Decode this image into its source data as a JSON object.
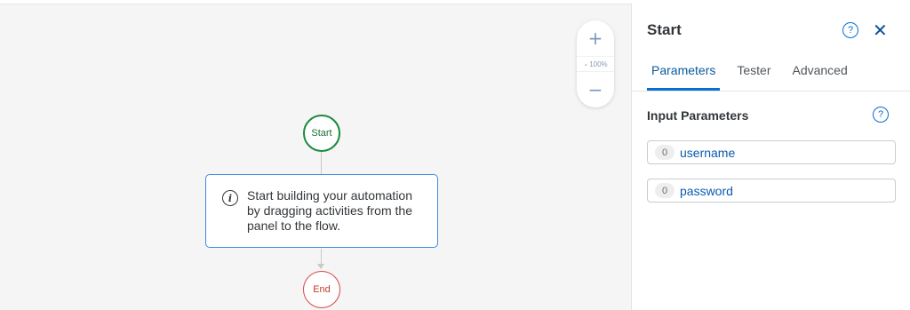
{
  "canvas": {
    "zoom": {
      "zoom_in_label": "+",
      "zoom_level": "100%",
      "zoom_out_label": "−"
    },
    "flow": {
      "start_label": "Start",
      "info_text": "Start building your automation by dragging activities from the panel to the flow.",
      "info_icon": "info-icon",
      "end_label": "End"
    }
  },
  "panel": {
    "title": "Start",
    "close_label": "✕",
    "help_label": "?",
    "tabs": [
      {
        "label": "Parameters",
        "active": true
      },
      {
        "label": "Tester",
        "active": false
      },
      {
        "label": "Advanced",
        "active": false
      }
    ],
    "section_title": "Input Parameters",
    "params": [
      {
        "badge": "0",
        "name": "username"
      },
      {
        "badge": "0",
        "name": "password"
      }
    ]
  },
  "colors": {
    "accent": "#0a6ed1",
    "start_node": "#1a8b3d",
    "end_node": "#d94848",
    "info_border": "#3f8be0"
  }
}
